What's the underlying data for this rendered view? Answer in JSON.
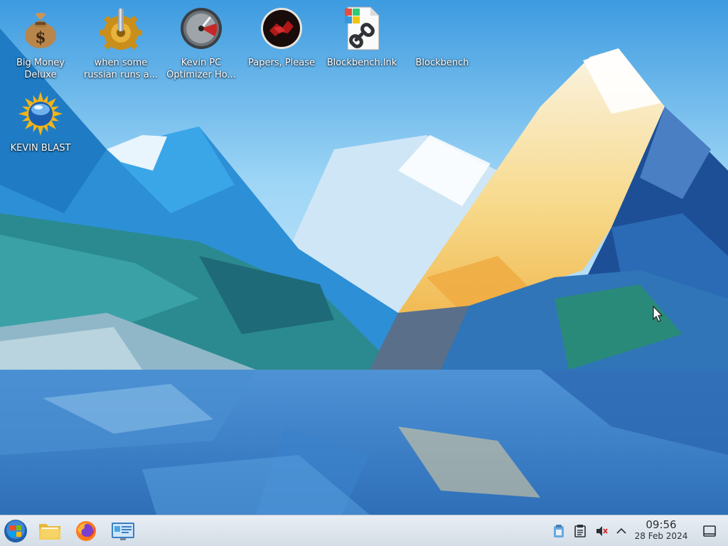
{
  "desktop": {
    "icons": [
      {
        "label": "Big Money Deluxe",
        "icon": "money-bag-icon"
      },
      {
        "label": "when some russian runs a...",
        "icon": "gear-icon"
      },
      {
        "label": "Kevin PC Optimizer Ho...",
        "icon": "speedometer-icon"
      },
      {
        "label": "Papers, Please",
        "icon": "papers-please-icon"
      },
      {
        "label": "Blockbench.lnk",
        "icon": "shortcut-file-icon"
      },
      {
        "label": "Blockbench",
        "icon": "blank-icon"
      },
      {
        "label": "KEVIN BLAST",
        "icon": "sun-globe-icon"
      }
    ]
  },
  "taskbar": {
    "launchers": [
      {
        "name": "start-menu",
        "icon": "windows-orb-icon"
      },
      {
        "name": "file-manager",
        "icon": "folder-icon"
      },
      {
        "name": "firefox",
        "icon": "firefox-icon"
      },
      {
        "name": "control-panel",
        "icon": "control-panel-icon"
      }
    ],
    "tray": [
      "clipboard-icon",
      "notes-icon",
      "volume-muted-icon",
      "chevron-up-icon"
    ],
    "clock": {
      "time": "09:56",
      "date": "28 Feb 2024"
    },
    "show_desktop": "show-desktop-icon"
  },
  "colors": {
    "taskbar_bg": "#dde4eb",
    "label_text": "#ffffff"
  }
}
